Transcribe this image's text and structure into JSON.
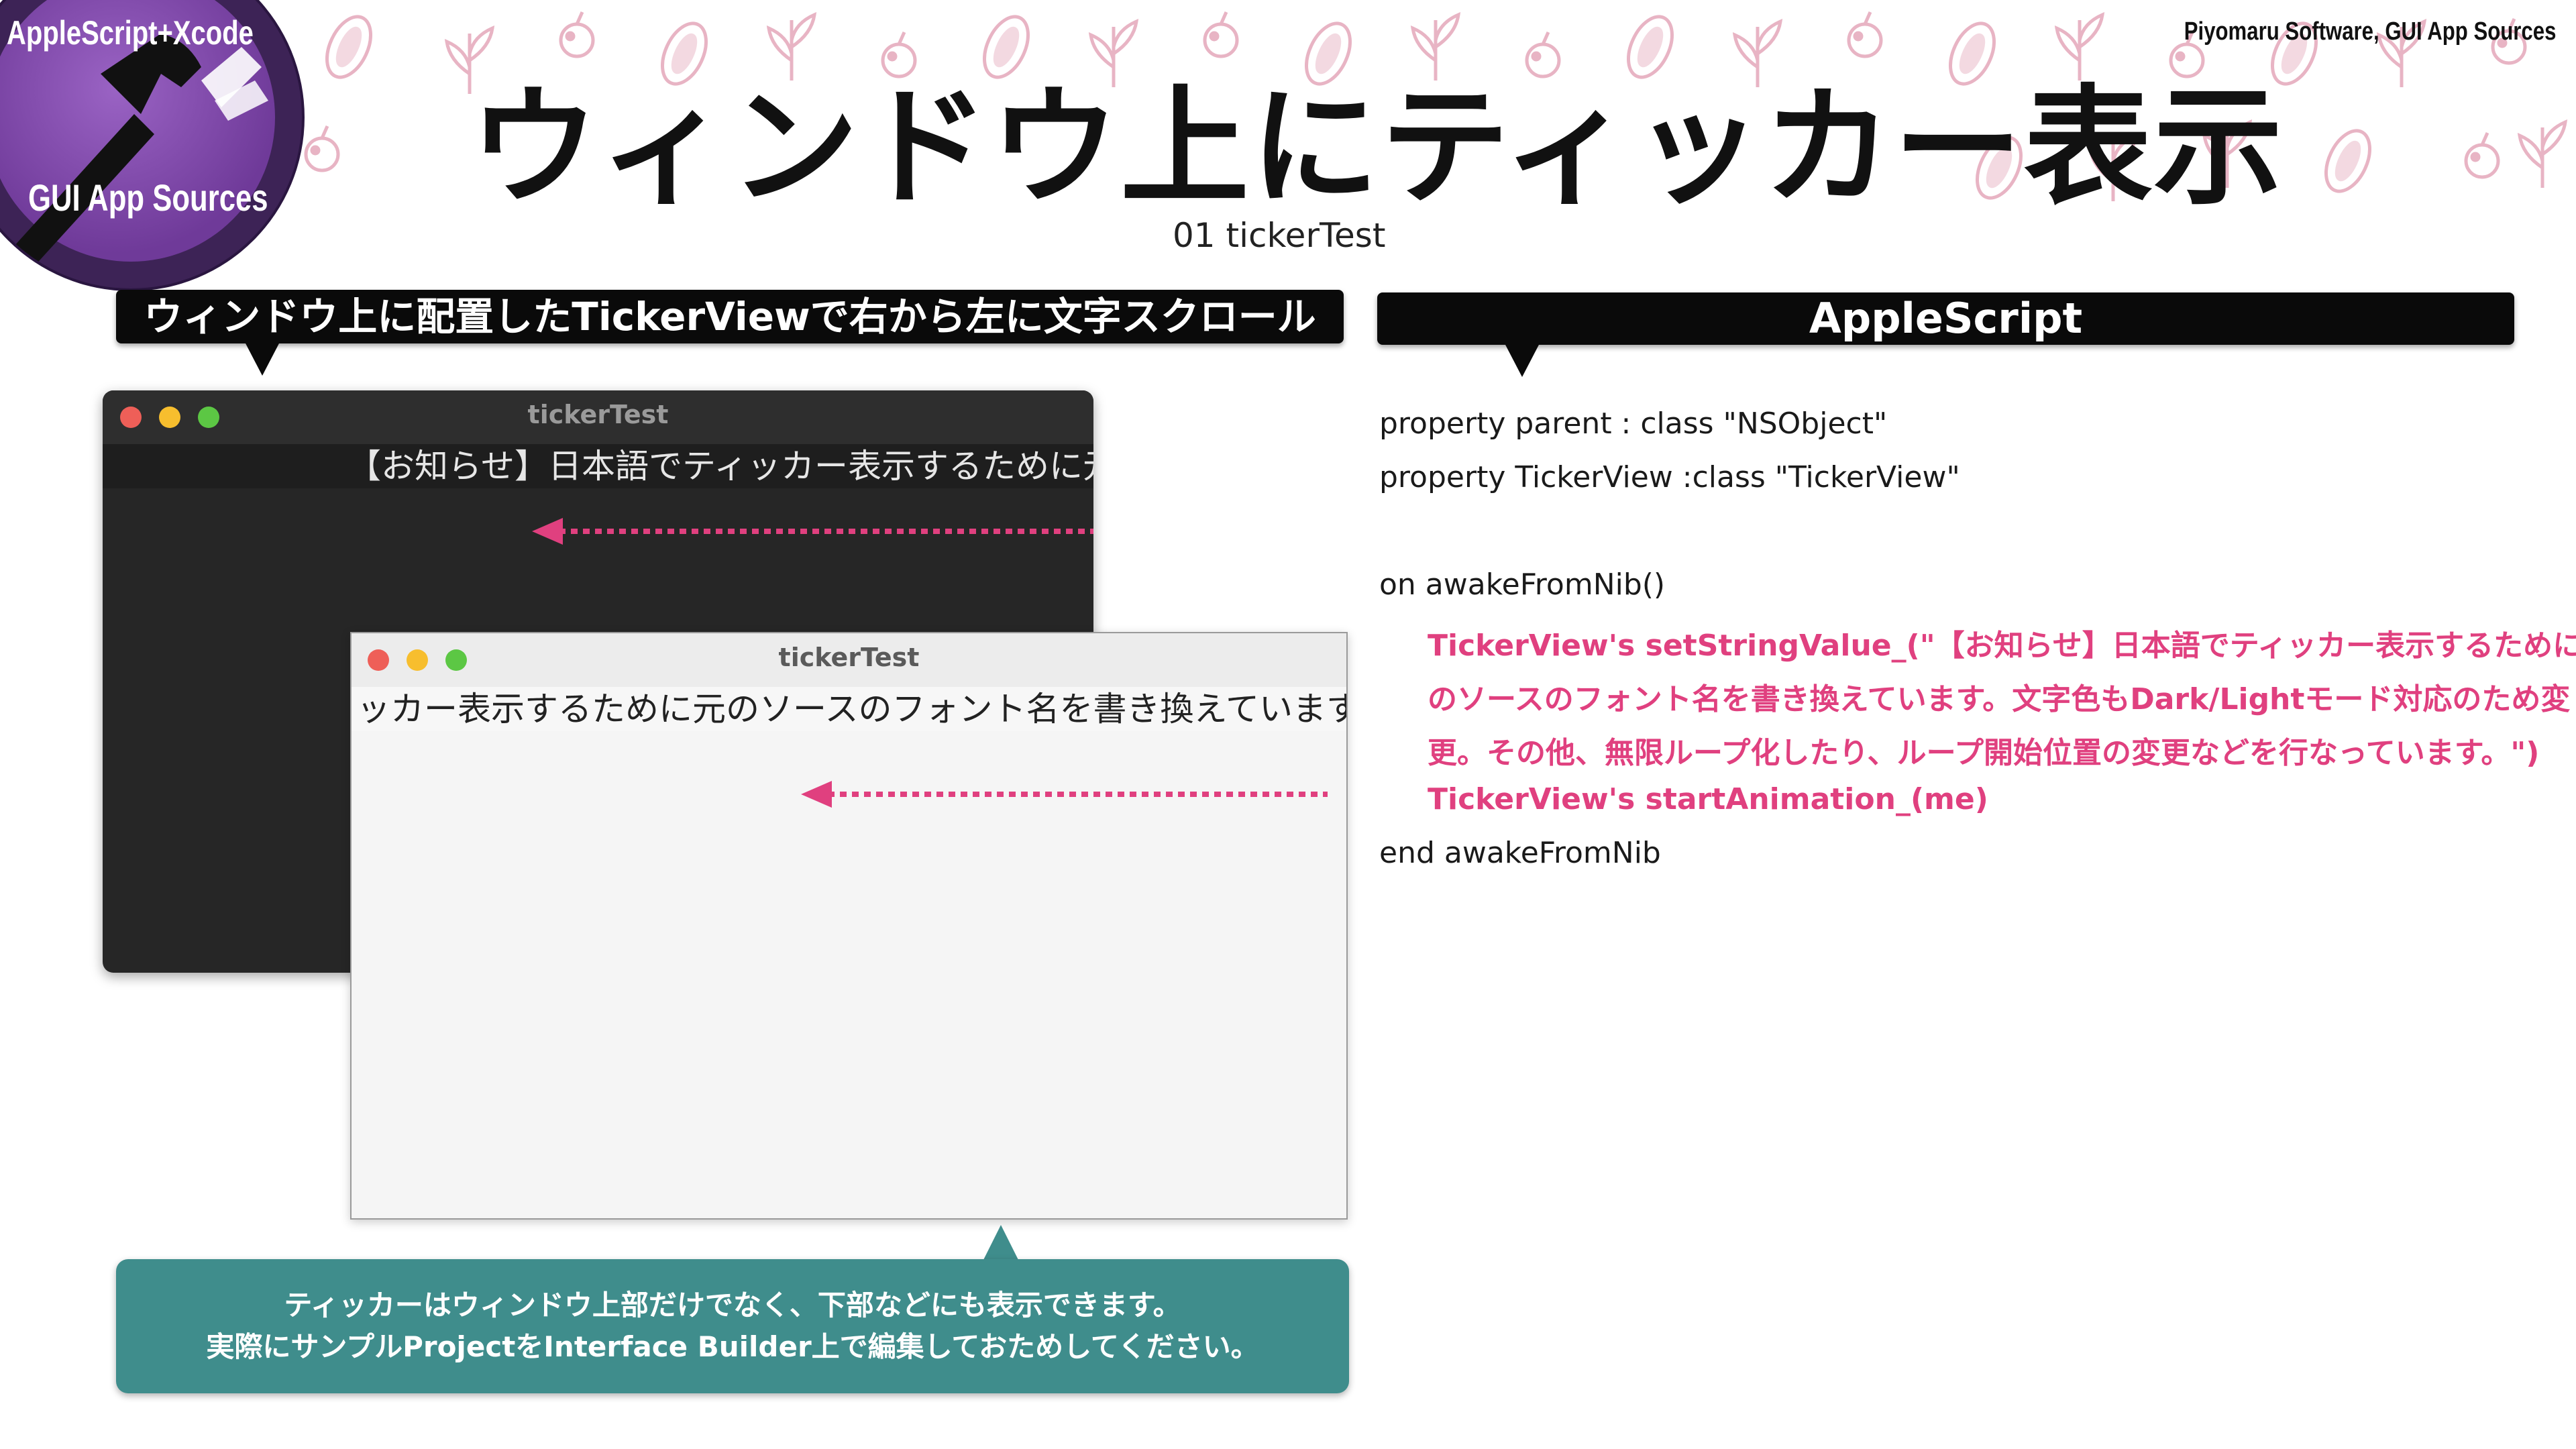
{
  "header": {
    "logo_top": "AppleScript+Xcode",
    "logo_bottom": "GUI App Sources",
    "brand": "Piyomaru Software, GUI App Sources",
    "title": "ウィンドウ上にティッカー表示",
    "subtitle": "01 tickerTest"
  },
  "left_panel": {
    "label": "ウィンドウ上に配置したTickerViewで右から左に文字スクロール",
    "dark_window": {
      "title": "tickerTest",
      "ticker_text": "【お知らせ】日本語でティッカー表示するために元"
    },
    "light_window": {
      "title": "tickerTest",
      "ticker_text": "ッカー表示するために元のソースのフォント名を書き換えています。"
    },
    "note_lines": [
      "ティッカーはウィンドウ上部だけでなく、下部などにも表示できます。",
      "実際にサンプルProjectをInterface Builder上で編集しておためしてください。"
    ]
  },
  "right_panel": {
    "label": "AppleScript",
    "code_lines": [
      {
        "text": "property parent : class \"NSObject\"",
        "style": "plain"
      },
      {
        "text": "property TickerView :class \"TickerView\"",
        "style": "plain"
      },
      {
        "text": "on awakeFromNib()",
        "style": "plain"
      },
      {
        "text": "TickerView's setStringValue_(\"【お知らせ】日本語でティッカー表示するために元",
        "style": "pink"
      },
      {
        "text": "のソースのフォント名を書き換えています。文字色もDark/Lightモード対応のため変",
        "style": "pink"
      },
      {
        "text": "更。その他、無限ループ化したり、ループ開始位置の変更などを行なっています。\")",
        "style": "pink"
      },
      {
        "text": "TickerView's startAnimation_(me)",
        "style": "pink"
      },
      {
        "text": "end awakeFromNib",
        "style": "plain"
      }
    ]
  },
  "colors": {
    "accent_pink": "#e0407f",
    "note_teal": "#3f8d8c",
    "logo_purple": "#6f3a99",
    "pattern_pink": "#e8b4c4"
  }
}
